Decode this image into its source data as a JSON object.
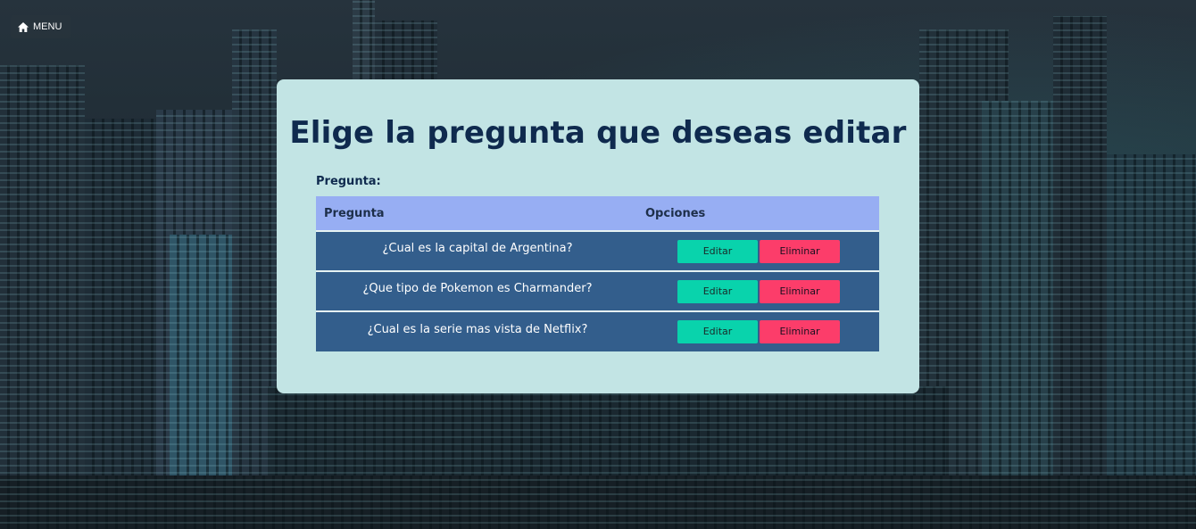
{
  "header": {
    "menu_label": "MENU",
    "menu_icon": "home-icon"
  },
  "card": {
    "title": "Elige la pregunta que deseas editar",
    "field_label": "Pregunta:"
  },
  "table": {
    "columns": [
      "Pregunta",
      "Opciones"
    ],
    "rows": [
      {
        "question": "¿Cual es la capital de Argentina?",
        "edit_label": "Editar",
        "delete_label": "Eliminar"
      },
      {
        "question": "¿Que tipo de Pokemon es Charmander?",
        "edit_label": "Editar",
        "delete_label": "Eliminar"
      },
      {
        "question": "¿Cual es la serie mas vista de Netflix?",
        "edit_label": "Editar",
        "delete_label": "Eliminar"
      }
    ]
  },
  "colors": {
    "card_bg": "#c2e4e4",
    "title": "#0f2a4e",
    "header_row": "#97aef3",
    "body_row": "#335e8c",
    "edit_button": "#09d3ac",
    "delete_button": "#fc3d6a"
  }
}
